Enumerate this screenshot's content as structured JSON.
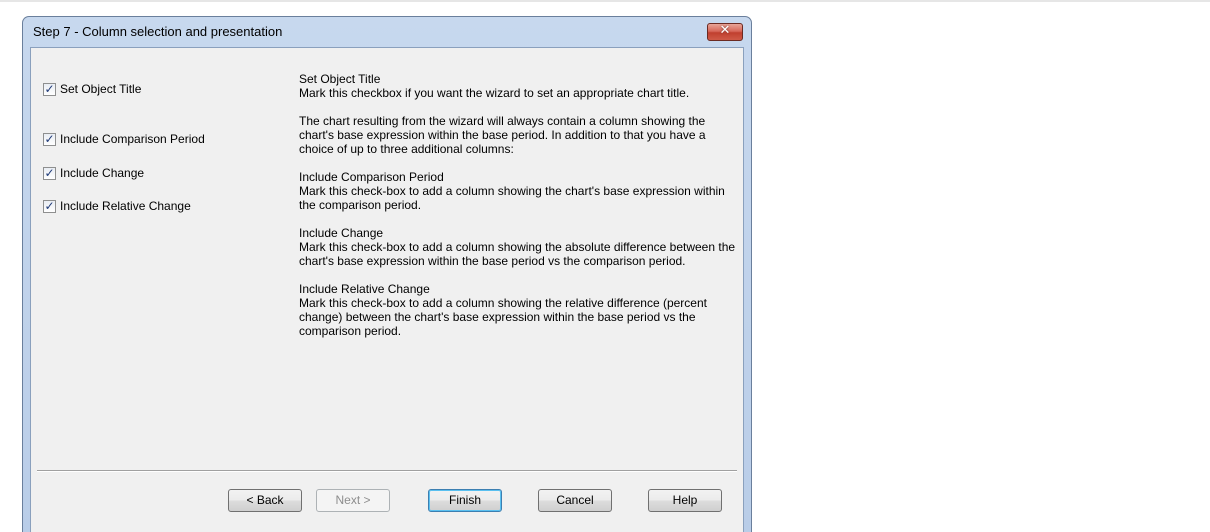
{
  "window": {
    "title": "Step 7 - Column selection and presentation",
    "close_glyph": "✕"
  },
  "options": [
    {
      "label": "Set Object Title",
      "checked": true
    },
    {
      "label": "Include Comparison Period",
      "checked": true
    },
    {
      "label": "Include Change",
      "checked": true
    },
    {
      "label": "Include Relative Change",
      "checked": true
    }
  ],
  "check_glyph": "✓",
  "help": {
    "set_title_heading": "Set Object Title",
    "set_title_text": "Mark this checkbox if you want the wizard to set an appropriate chart title.",
    "intro": "The chart resulting from the wizard will always contain a column showing the chart's base expression within the base period. In addition to that you have a choice of up to three additional columns:",
    "comparison_heading": "Include Comparison Period",
    "comparison_text": "Mark this check-box to add a column showing the chart's base expression within the comparison period.",
    "change_heading": "Include Change",
    "change_text": "Mark this check-box to add a column showing the absolute difference between the chart's base expression within the base period vs the comparison period.",
    "relative_heading": "Include Relative Change",
    "relative_text": "Mark this check-box to add a column showing the relative difference (percent change) between the chart's base expression within the base period vs the comparison period."
  },
  "buttons": {
    "back": "< Back",
    "next": "Next >",
    "finish": "Finish",
    "cancel": "Cancel",
    "help": "Help"
  }
}
